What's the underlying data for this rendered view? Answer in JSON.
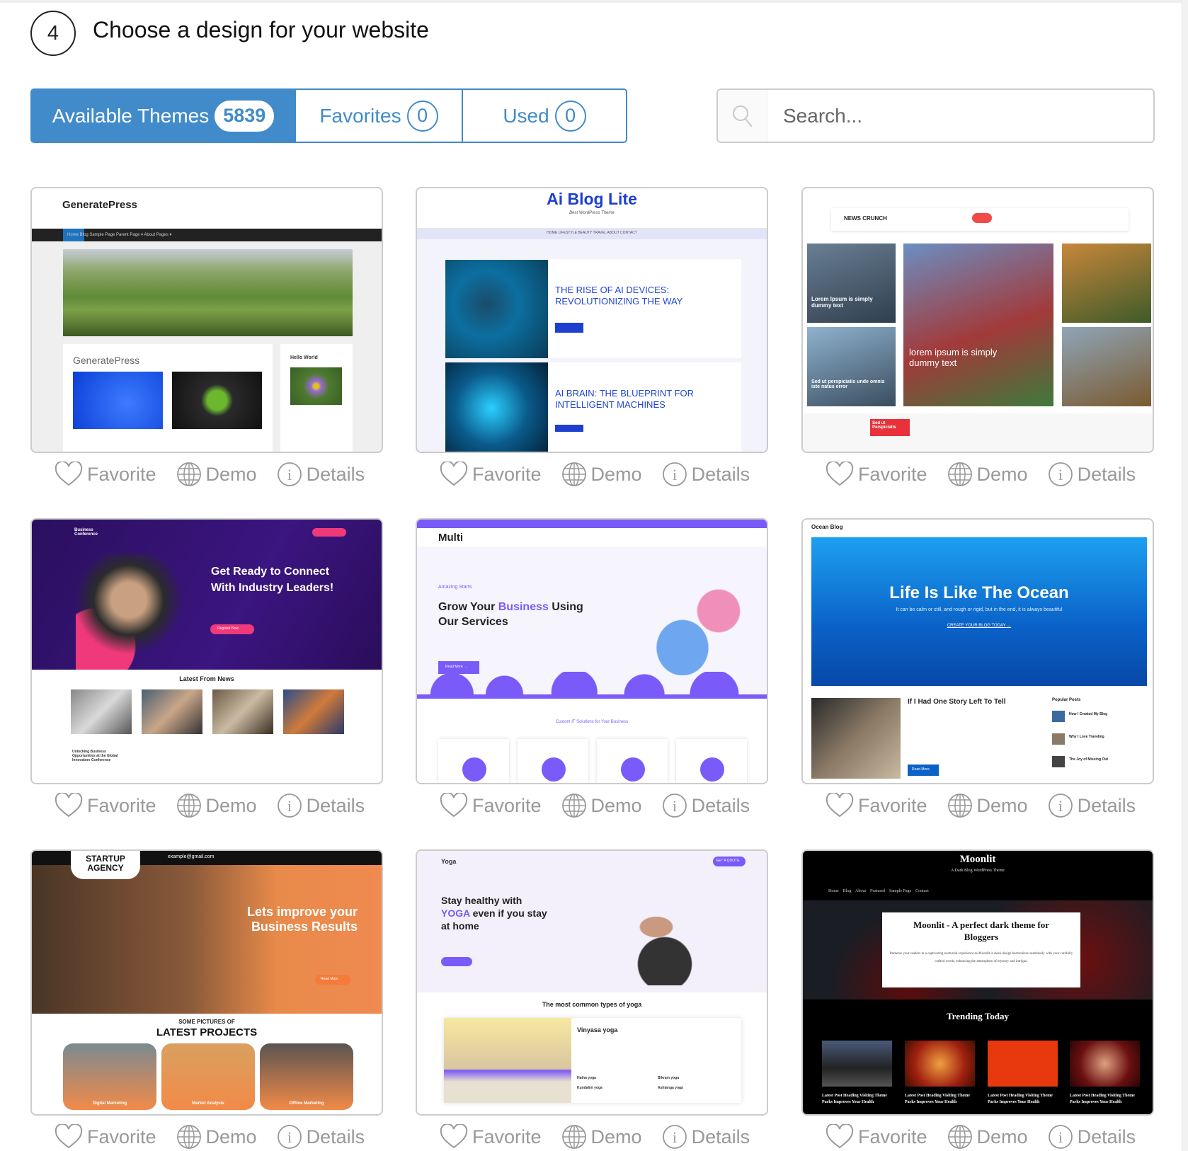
{
  "step": {
    "number": "4",
    "title": "Choose a design for your website"
  },
  "tabs": [
    {
      "label": "Available Themes",
      "count": "5839",
      "active": true
    },
    {
      "label": "Favorites",
      "count": "0",
      "active": false
    },
    {
      "label": "Used",
      "count": "0",
      "active": false
    }
  ],
  "search": {
    "placeholder": "Search...",
    "value": ""
  },
  "actions": {
    "favorite": "Favorite",
    "demo": "Demo",
    "details": "Details"
  },
  "colors": {
    "accent": "#418bca",
    "action_gray": "#999999"
  },
  "themes": [
    {
      "name": "GeneratePress",
      "texts": {
        "logo": "GeneratePress",
        "nav": "Home   Blog   Sample Page   Parent Page ▾   About   Pages ▾",
        "post_title": "GeneratePress",
        "sidebar": "Hello World"
      }
    },
    {
      "name": "Ai Blog Lite",
      "texts": {
        "logo": "Ai Blog Lite",
        "tagline": "Best WordPress Theme",
        "nav": "HOME   LIFESTYLE   BEAUTY   TRAVEL   ABOUT   CONTACT",
        "post1": "THE RISE OF AI DEVICES: REVOLUTIONIZING THE WAY",
        "post2": "AI BRAIN: THE BLUEPRINT FOR INTELLIGENT MACHINES"
      }
    },
    {
      "name": "News Crunch",
      "texts": {
        "logo": "NEWS CRUNCH",
        "caption1": "Lorem Ipsum is simply dummy text",
        "caption2": "lorem ipsum is simply dummy text",
        "caption3": "Sed ut perspiciatis unde omnis iste natus error",
        "ticker": "Sed ut Perspiciatis"
      }
    },
    {
      "name": "Business Conference",
      "texts": {
        "logo": "Business Conference",
        "headline": "Get Ready to Connect With Industry Leaders!",
        "button": "Register Now",
        "section": "Latest From News",
        "post": "Unlocking Business Opportunities at the Global Innovators Conference"
      }
    },
    {
      "name": "Multi",
      "texts": {
        "logo": "Multi",
        "kicker": "Amazing Starts",
        "headline_a": "Grow Your ",
        "headline_b": "Business",
        "headline_c": " Using Our Services",
        "button": "Read More →",
        "section": "Custom IT Solutions for Your Business"
      }
    },
    {
      "name": "Ocean Blog",
      "texts": {
        "logo": "Ocean Blog",
        "headline": "Life Is Like The Ocean",
        "sub": "It can be calm or still, and rough or rigid, but in the end, it is always beautiful",
        "cta": "CREATE YOUR BLOG TODAY →",
        "post": "If I Had One Story Left To Tell",
        "popular": "Popular Posts",
        "p1": "How I Created My Blog",
        "p2": "Why I Love Traveling",
        "p3": "The Joy of Missing Out",
        "button": "Read More"
      }
    },
    {
      "name": "Startup Agency",
      "texts": {
        "logo": "STARTUP AGENCY",
        "email": "example@gmail.com",
        "headline": "Lets improve your Business Results",
        "button": "Read More",
        "kicker": "SOME PICTURES OF",
        "section": "LATEST PROJECTS",
        "p1": "Digital Marketing",
        "p2": "Market Analysis",
        "p3": "Offline Marketing"
      }
    },
    {
      "name": "Yoga",
      "texts": {
        "logo": "Yoga",
        "h1": "Stay healthy with",
        "h2a": "YOGA",
        "h2b": " even if you stay",
        "h3": "at home",
        "quote": "GET A QUOTE",
        "section": "The most common types of yoga",
        "type": "Vinyasa yoga",
        "l1": "Hatha yoga",
        "l2": "Kundalini yoga",
        "l3": "Bikram yoga",
        "l4": "Ashtanga yoga"
      }
    },
    {
      "name": "Moonlit",
      "texts": {
        "logo": "Moonlit",
        "tagline": "A Dark Blog WordPress Theme",
        "nav": "Home    Blog    About    Featured    Sample Page    Contact",
        "headline": "Moonlit - A perfect dark theme for Bloggers",
        "body": "Immerse your readers in a captivating nocturnal experience as Moonlit is sleek design harmonizes seamlessly with your carefully crafted words, enhancing the atmosphere of mystery and intrigue.",
        "section": "Trending Today",
        "post": "Latest Post Heading Visiting Theme Parks Improves Your Health"
      }
    }
  ]
}
